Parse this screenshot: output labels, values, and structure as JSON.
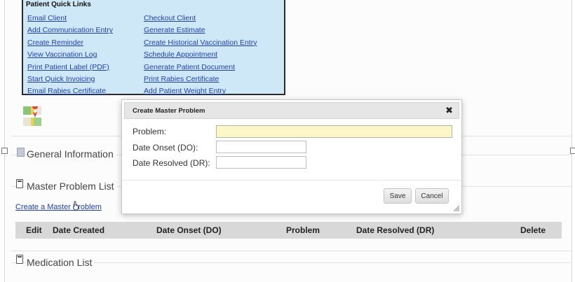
{
  "quick_links": {
    "title": "Patient Quick Links",
    "left": [
      "Email Client",
      "Add Communication Entry",
      "Create Reminder",
      "View Vaccination Log",
      "Print Patient Label (PDF)",
      "Start Quick Invoicing",
      "Email Rabies Certificate"
    ],
    "right": [
      "Checkout Client",
      "Generate Estimate",
      "Create Historical Vaccination Entry",
      "Schedule Appointment",
      "Generate Patient Document",
      "Print Rabies Certificate",
      "Add Patient Weight Entry"
    ]
  },
  "sections": {
    "general": "General Information",
    "master_problem": "Master Problem List",
    "medication": "Medication List"
  },
  "create_master_problem_link": "Create a Master Problem",
  "table": {
    "headers": [
      "Edit",
      "Date Created",
      "Date Onset (DO)",
      "Problem",
      "Date Resolved (DR)",
      "Delete"
    ]
  },
  "modal": {
    "title": "Create Master Problem",
    "close": "✖",
    "fields": {
      "problem_label": "Problem:",
      "problem_value": "",
      "onset_label": "Date Onset (DO):",
      "onset_value": "",
      "resolved_label": "Date Resolved (DR):",
      "resolved_value": ""
    },
    "save_label": "Save",
    "cancel_label": "Cancel"
  },
  "colors": {
    "link": "#1f3fb0",
    "quick_links_bg": "#cfe8f7",
    "input_highlight": "#fbf7c8",
    "table_header_bg": "#d8d8d8"
  }
}
